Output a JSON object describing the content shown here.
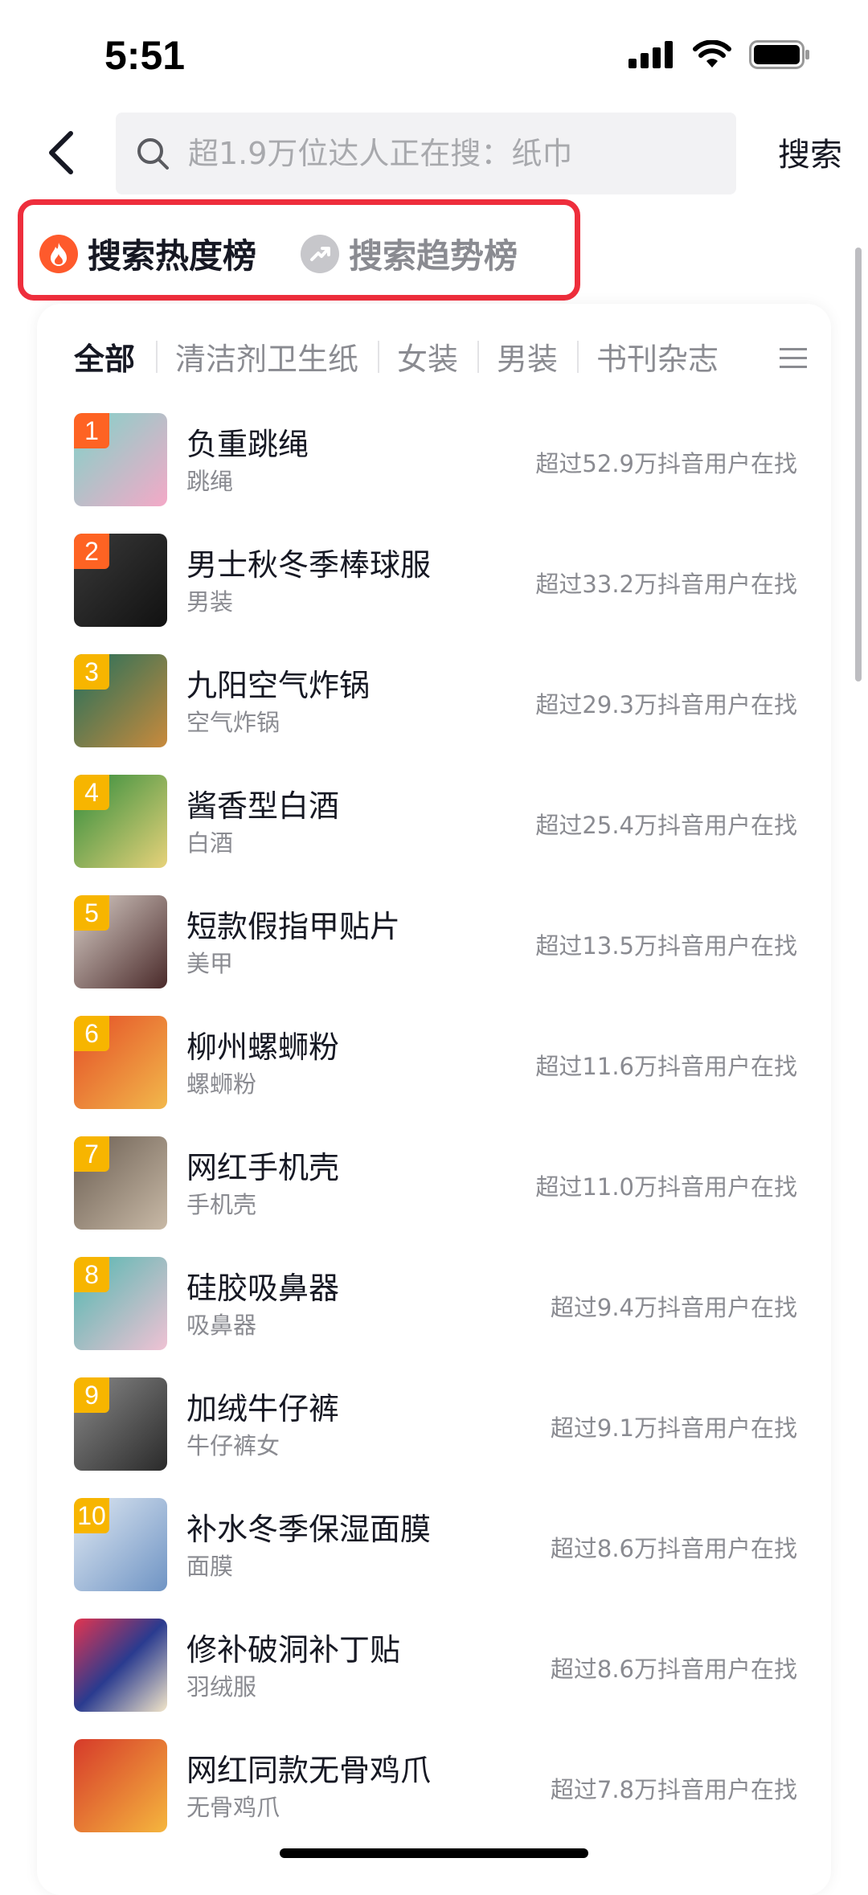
{
  "status": {
    "time": "5:51"
  },
  "search": {
    "placeholder": "超1.9万位达人正在搜：纸巾",
    "button": "搜索"
  },
  "rank_tabs": [
    {
      "label": "搜索热度榜",
      "icon": "flame-icon",
      "active": true
    },
    {
      "label": "搜索趋势榜",
      "icon": "trend-arrow-icon",
      "active": false
    }
  ],
  "categories": [
    "全部",
    "清洁剂卫生纸",
    "女装",
    "男装",
    "书刊杂志"
  ],
  "colors": {
    "accent_red": "#ee2e3c",
    "rank_orange": "#fe6323",
    "rank_yellow": "#f7b500"
  },
  "items": [
    {
      "rank": "1",
      "title": "负重跳绳",
      "sub": "跳绳",
      "meta": "超过52.9万抖音用户在找"
    },
    {
      "rank": "2",
      "title": "男士秋冬季棒球服",
      "sub": "男装",
      "meta": "超过33.2万抖音用户在找"
    },
    {
      "rank": "3",
      "title": "九阳空气炸锅",
      "sub": "空气炸锅",
      "meta": "超过29.3万抖音用户在找"
    },
    {
      "rank": "4",
      "title": "酱香型白酒",
      "sub": "白酒",
      "meta": "超过25.4万抖音用户在找"
    },
    {
      "rank": "5",
      "title": "短款假指甲贴片",
      "sub": "美甲",
      "meta": "超过13.5万抖音用户在找"
    },
    {
      "rank": "6",
      "title": "柳州螺蛳粉",
      "sub": "螺蛳粉",
      "meta": "超过11.6万抖音用户在找"
    },
    {
      "rank": "7",
      "title": "网红手机壳",
      "sub": "手机壳",
      "meta": "超过11.0万抖音用户在找"
    },
    {
      "rank": "8",
      "title": "硅胶吸鼻器",
      "sub": "吸鼻器",
      "meta": "超过9.4万抖音用户在找"
    },
    {
      "rank": "9",
      "title": "加绒牛仔裤",
      "sub": "牛仔裤女",
      "meta": "超过9.1万抖音用户在找"
    },
    {
      "rank": "10",
      "title": "补水冬季保湿面膜",
      "sub": "面膜",
      "meta": "超过8.6万抖音用户在找"
    },
    {
      "rank": "",
      "title": "修补破洞补丁贴",
      "sub": "羽绒服",
      "meta": "超过8.6万抖音用户在找"
    },
    {
      "rank": "",
      "title": "网红同款无骨鸡爪",
      "sub": "无骨鸡爪",
      "meta": "超过7.8万抖音用户在找"
    }
  ]
}
